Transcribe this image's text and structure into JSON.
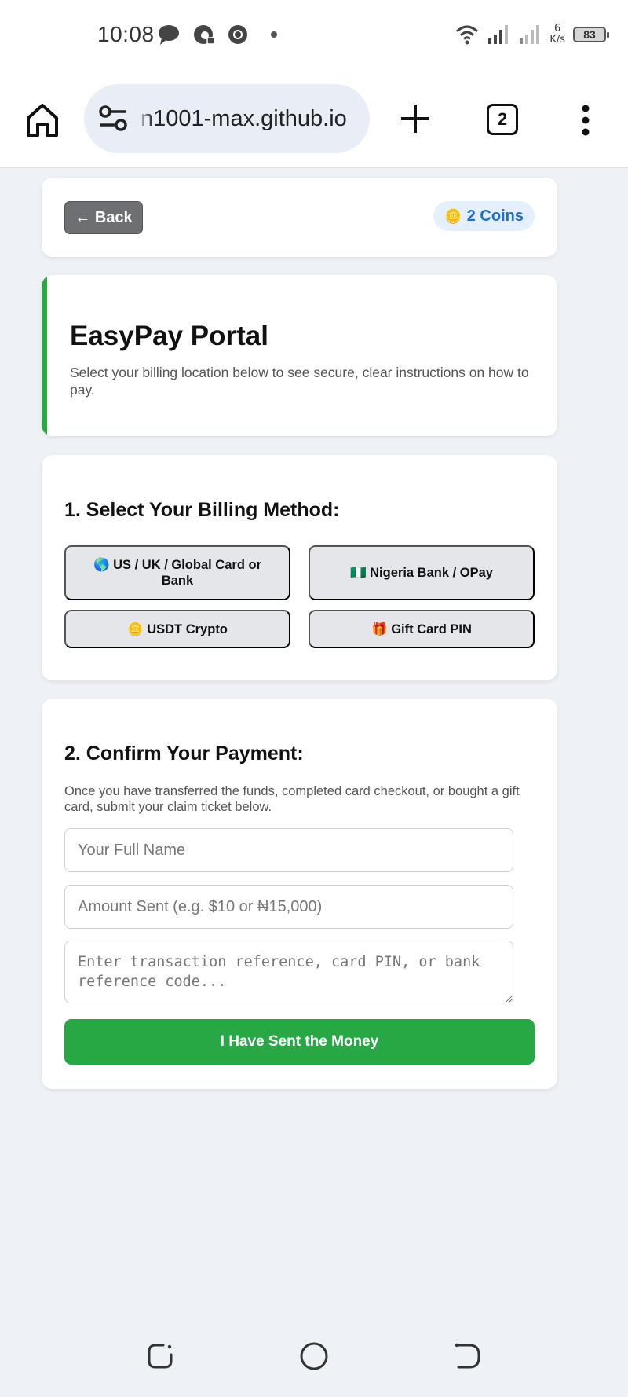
{
  "status_bar": {
    "time": "10:08",
    "net_speed_value": "6",
    "net_speed_unit": "K/s",
    "battery_level": "83",
    "notification_icons": [
      "chat-bubble-icon",
      "vpn-globe-icon",
      "chrome-icon",
      "more-dot-icon"
    ],
    "system_icons": [
      "wifi-icon",
      "signal-icon",
      "signal-icon",
      "battery-icon"
    ]
  },
  "browser": {
    "url": "n1001-max.github.io",
    "tab_count": "2",
    "icons": [
      "home-icon",
      "site-settings-icon",
      "new-tab-icon",
      "tab-switcher-icon",
      "more-menu-icon"
    ]
  },
  "top_card": {
    "back_label": "← Back",
    "coins_icon": "🪙",
    "coins_label": "2 Coins"
  },
  "hero": {
    "title": "EasyPay Portal",
    "subtitle": "Select your billing location below to see secure, clear instructions on how to pay.",
    "accent_color": "#2ca843"
  },
  "billing": {
    "title": "1. Select Your Billing Method:",
    "methods": [
      {
        "label": "🌎 US / UK / Global Card or Bank"
      },
      {
        "label": "🇳🇬 Nigeria Bank / OPay"
      },
      {
        "label": "🪙 USDT Crypto"
      },
      {
        "label": "🎁 Gift Card PIN"
      }
    ]
  },
  "confirm": {
    "title": "2. Confirm Your Payment:",
    "description": "Once you have transferred the funds, completed card checkout, or bought a gift card, submit your claim ticket below.",
    "name_placeholder": "Your Full Name",
    "amount_placeholder": "Amount Sent (e.g. $10 or ₦15,000)",
    "reference_placeholder": "Enter transaction reference, card PIN, or bank reference code...",
    "submit_label": "I Have Sent the Money",
    "submit_color": "#28a745"
  },
  "nav_bar": {
    "icons": [
      "recents-icon",
      "home-circle-icon",
      "back-icon"
    ]
  }
}
